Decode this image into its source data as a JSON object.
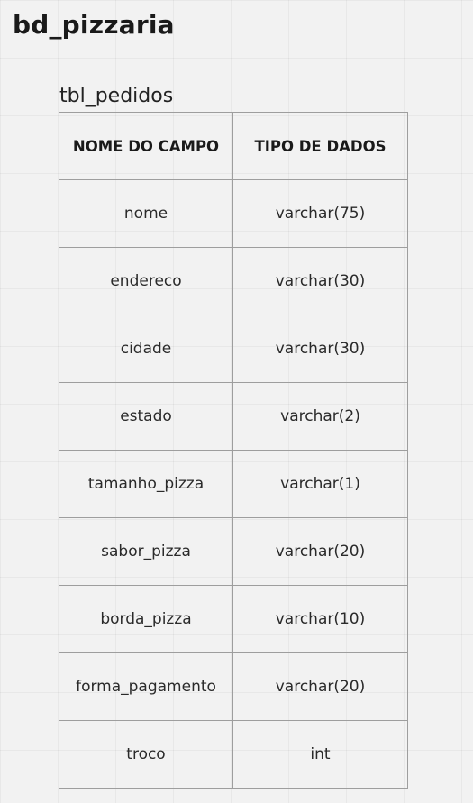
{
  "database": {
    "name": "bd_pizzaria"
  },
  "table": {
    "name": "tbl_pedidos",
    "headers": {
      "field_name": "NOME DO CAMPO",
      "data_type": "TIPO DE DADOS"
    },
    "rows": [
      {
        "field": "nome",
        "type": "varchar(75)"
      },
      {
        "field": "endereco",
        "type": "varchar(30)"
      },
      {
        "field": "cidade",
        "type": "varchar(30)"
      },
      {
        "field": "estado",
        "type": "varchar(2)"
      },
      {
        "field": "tamanho_pizza",
        "type": "varchar(1)"
      },
      {
        "field": "sabor_pizza",
        "type": "varchar(20)"
      },
      {
        "field": "borda_pizza",
        "type": "varchar(10)"
      },
      {
        "field": "forma_pagamento",
        "type": "varchar(20)"
      },
      {
        "field": "troco",
        "type": "int"
      }
    ]
  }
}
